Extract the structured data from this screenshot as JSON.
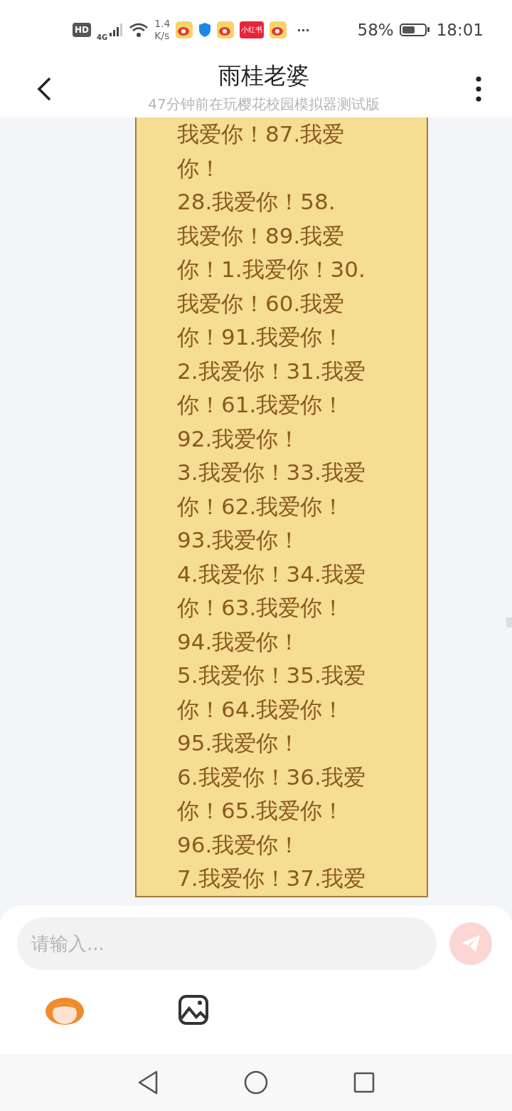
{
  "status_bar": {
    "network_badge": "HD",
    "network_type": "4G",
    "speed_value": "1.4",
    "speed_unit": "K/s",
    "app_badge": "小红书",
    "more": "···",
    "battery_percent": "58%",
    "time": "18:01"
  },
  "header": {
    "title": "雨桂老婆",
    "subtitle": "47分钟前在玩樱花校园模拟器测试版"
  },
  "message": {
    "lines": [
      "我爱你！87.我爱",
      "你！",
      "28.我爱你！58.",
      "我爱你！89.我爱",
      "你！1.我爱你！30.",
      "我爱你！60.我爱",
      "你！91.我爱你！",
      "2.我爱你！31.我爱",
      "你！61.我爱你！",
      "92.我爱你！",
      "3.我爱你！33.我爱",
      "你！62.我爱你！",
      "93.我爱你！",
      "4.我爱你！34.我爱",
      "你！63.我爱你！",
      "94.我爱你！",
      "5.我爱你！35.我爱",
      "你！64.我爱你！",
      "95.我爱你！",
      "6.我爱你！36.我爱",
      "你！65.我爱你！",
      "96.我爱你！",
      "7.我爱你！37.我爱"
    ]
  },
  "composer": {
    "placeholder": "请输入..."
  }
}
